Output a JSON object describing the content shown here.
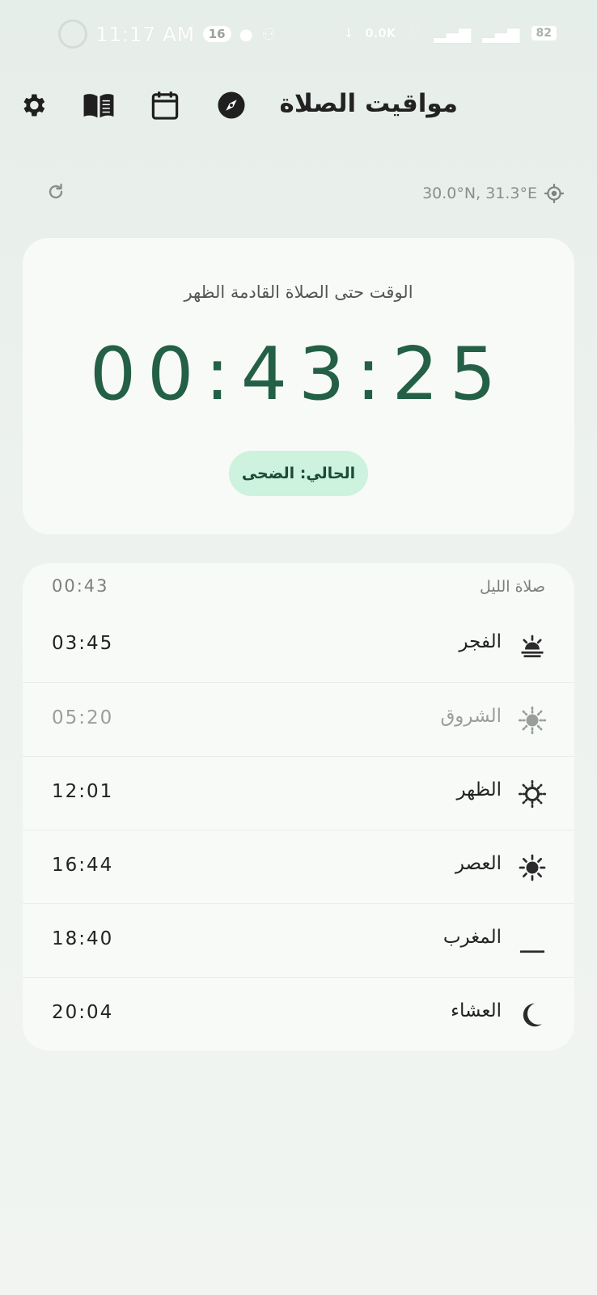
{
  "status_bar": {
    "time": "11:17 AM",
    "notification_count": "16",
    "net_speed": "0.0K",
    "battery": "82"
  },
  "toolbar": {
    "title": "مواقيت الصلاة",
    "icons": [
      "gear-icon",
      "book-icon",
      "calendar-icon",
      "compass-icon"
    ]
  },
  "location": {
    "coordinates": "30.0°N, 31.3°E"
  },
  "countdown": {
    "label": "الوقت حتى الصلاة القادمة الظهر",
    "time": "00:43:25",
    "current_badge": "الحالي: الضحى"
  },
  "night_prayer": {
    "name": "صلاة الليل",
    "time": "00:43"
  },
  "prayers": [
    {
      "name": "الفجر",
      "time": "03:45",
      "icon": "sunrise-icon",
      "muted": false
    },
    {
      "name": "الشروق",
      "time": "05:20",
      "icon": "sun-dotted-icon",
      "muted": true
    },
    {
      "name": "الظهر",
      "time": "12:01",
      "icon": "sun-outline-icon",
      "muted": false
    },
    {
      "name": "العصر",
      "time": "16:44",
      "icon": "sun-filled-icon",
      "muted": false
    },
    {
      "name": "المغرب",
      "time": "18:40",
      "icon": "moon-horizon-icon",
      "muted": false
    },
    {
      "name": "العشاء",
      "time": "20:04",
      "icon": "crescent-moon-icon",
      "muted": false
    }
  ],
  "colors": {
    "accent": "#236046",
    "badge_bg": "#cdf2dd",
    "muted": "#9a9e9b"
  }
}
